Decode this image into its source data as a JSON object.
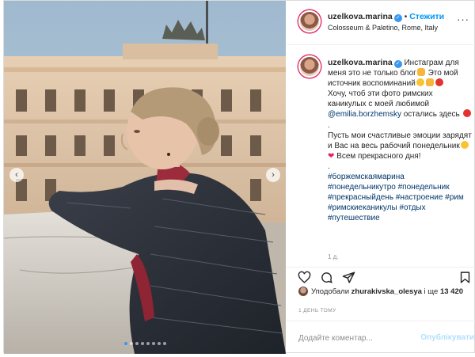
{
  "post": {
    "username": "uzelkova.marina",
    "follow_label": "Стежити",
    "separator": "•",
    "location": "Colosseum & Paletino, Rome, Italy",
    "more_label": "···"
  },
  "photo": {
    "description_icons": {
      "prev": "chevron-left-icon",
      "next": "chevron-right-icon"
    },
    "prev_glyph": "‹",
    "next_glyph": "›",
    "slide_count": 8,
    "active_slide": 1
  },
  "caption": {
    "line1_username": "uzelkova.marina",
    "p1_a": "Инстаграм для меня это не только блог",
    "p1_b": " Это мой источник воспоминаний",
    "p2_a": "Хочу, чтоб эти фото римских каникулых с моей любимой ",
    "mention": "@emilia.borzhemsky",
    "p2_b": " остались здесь ",
    "dot": ".",
    "p3_a": "Пусть мои счастливые эмоции зарядят и Вас на весь рабочий понедельник",
    "p3_b": " Всем прекрасного дня!",
    "dot2": ".",
    "tags": "#боржемскаямарина #понедельникутро #понедельник #прекрасныйдень #настроение #рим #римскиеканикулы #отдых #путешествие",
    "time_ago": "1 д."
  },
  "likes": {
    "prefix": "Уподобали ",
    "user": "zhurakivska_olesya",
    "middle": " і ще ",
    "count": "13 420"
  },
  "date_label": "1 ДЕНЬ ТОМУ",
  "comment": {
    "placeholder": "Додайте коментар...",
    "publish_label": "Опублікувати"
  },
  "colors": {
    "accent": "#0095f6",
    "verified": "#3897f0",
    "border": "#dbdbdb"
  }
}
